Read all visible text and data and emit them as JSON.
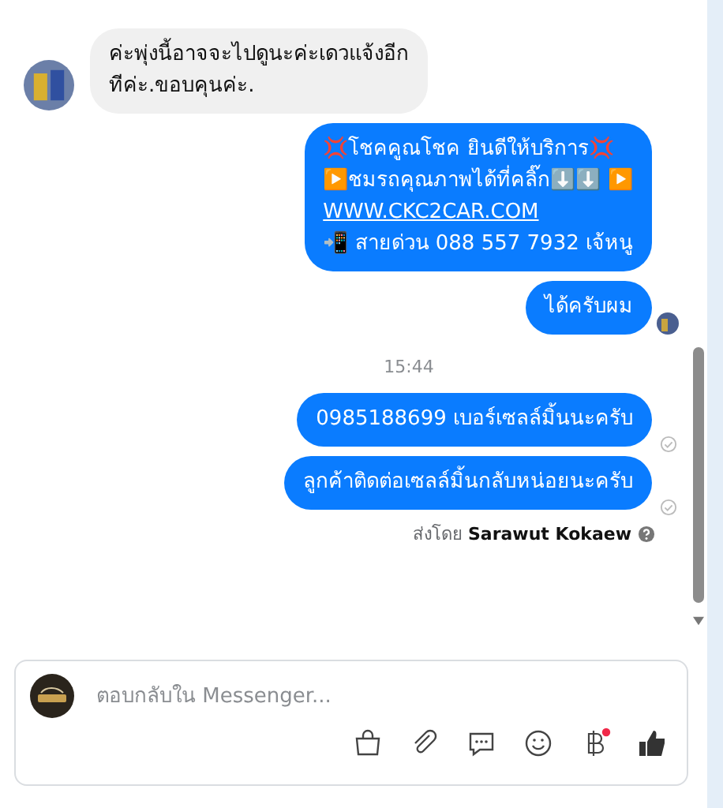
{
  "messages": [
    {
      "kind": "in",
      "avatar": true,
      "lines": [
        "ค่ะพุ่งนี้อาจจะไปดูนะค่ะเดวแจ้งอีก",
        "ทีค่ะ.ขอบคุนค่ะ."
      ]
    },
    {
      "kind": "out",
      "lines": [
        "💢โชคคูณโชค ยินดีให้บริการ💢",
        "▶️ชมรถคุณภาพได้ที่คลิ๊ก⬇️⬇️      ▶️"
      ],
      "link": "WWW.CKC2CAR.COM",
      "after": "📲 สายด่วน 088 557 7932 เจ้หนู"
    },
    {
      "kind": "out",
      "lines": [
        "ได้ครับผม"
      ],
      "seen": true
    },
    {
      "kind": "time",
      "text": "15:44"
    },
    {
      "kind": "out",
      "lines": [
        "0985188699 เบอร์เซลล์มิ้นนะครับ"
      ],
      "sent": true
    },
    {
      "kind": "out",
      "lines": [
        "ลูกค้าติดต่อเซลล์มิ้นกลับหน่อยนะครับ"
      ],
      "sent": true
    }
  ],
  "sent_by": {
    "label": "ส่งโดย",
    "name": "Sarawut Kokaew"
  },
  "composer": {
    "placeholder": "ตอบกลับใน Messenger...",
    "payment_badge": true
  }
}
